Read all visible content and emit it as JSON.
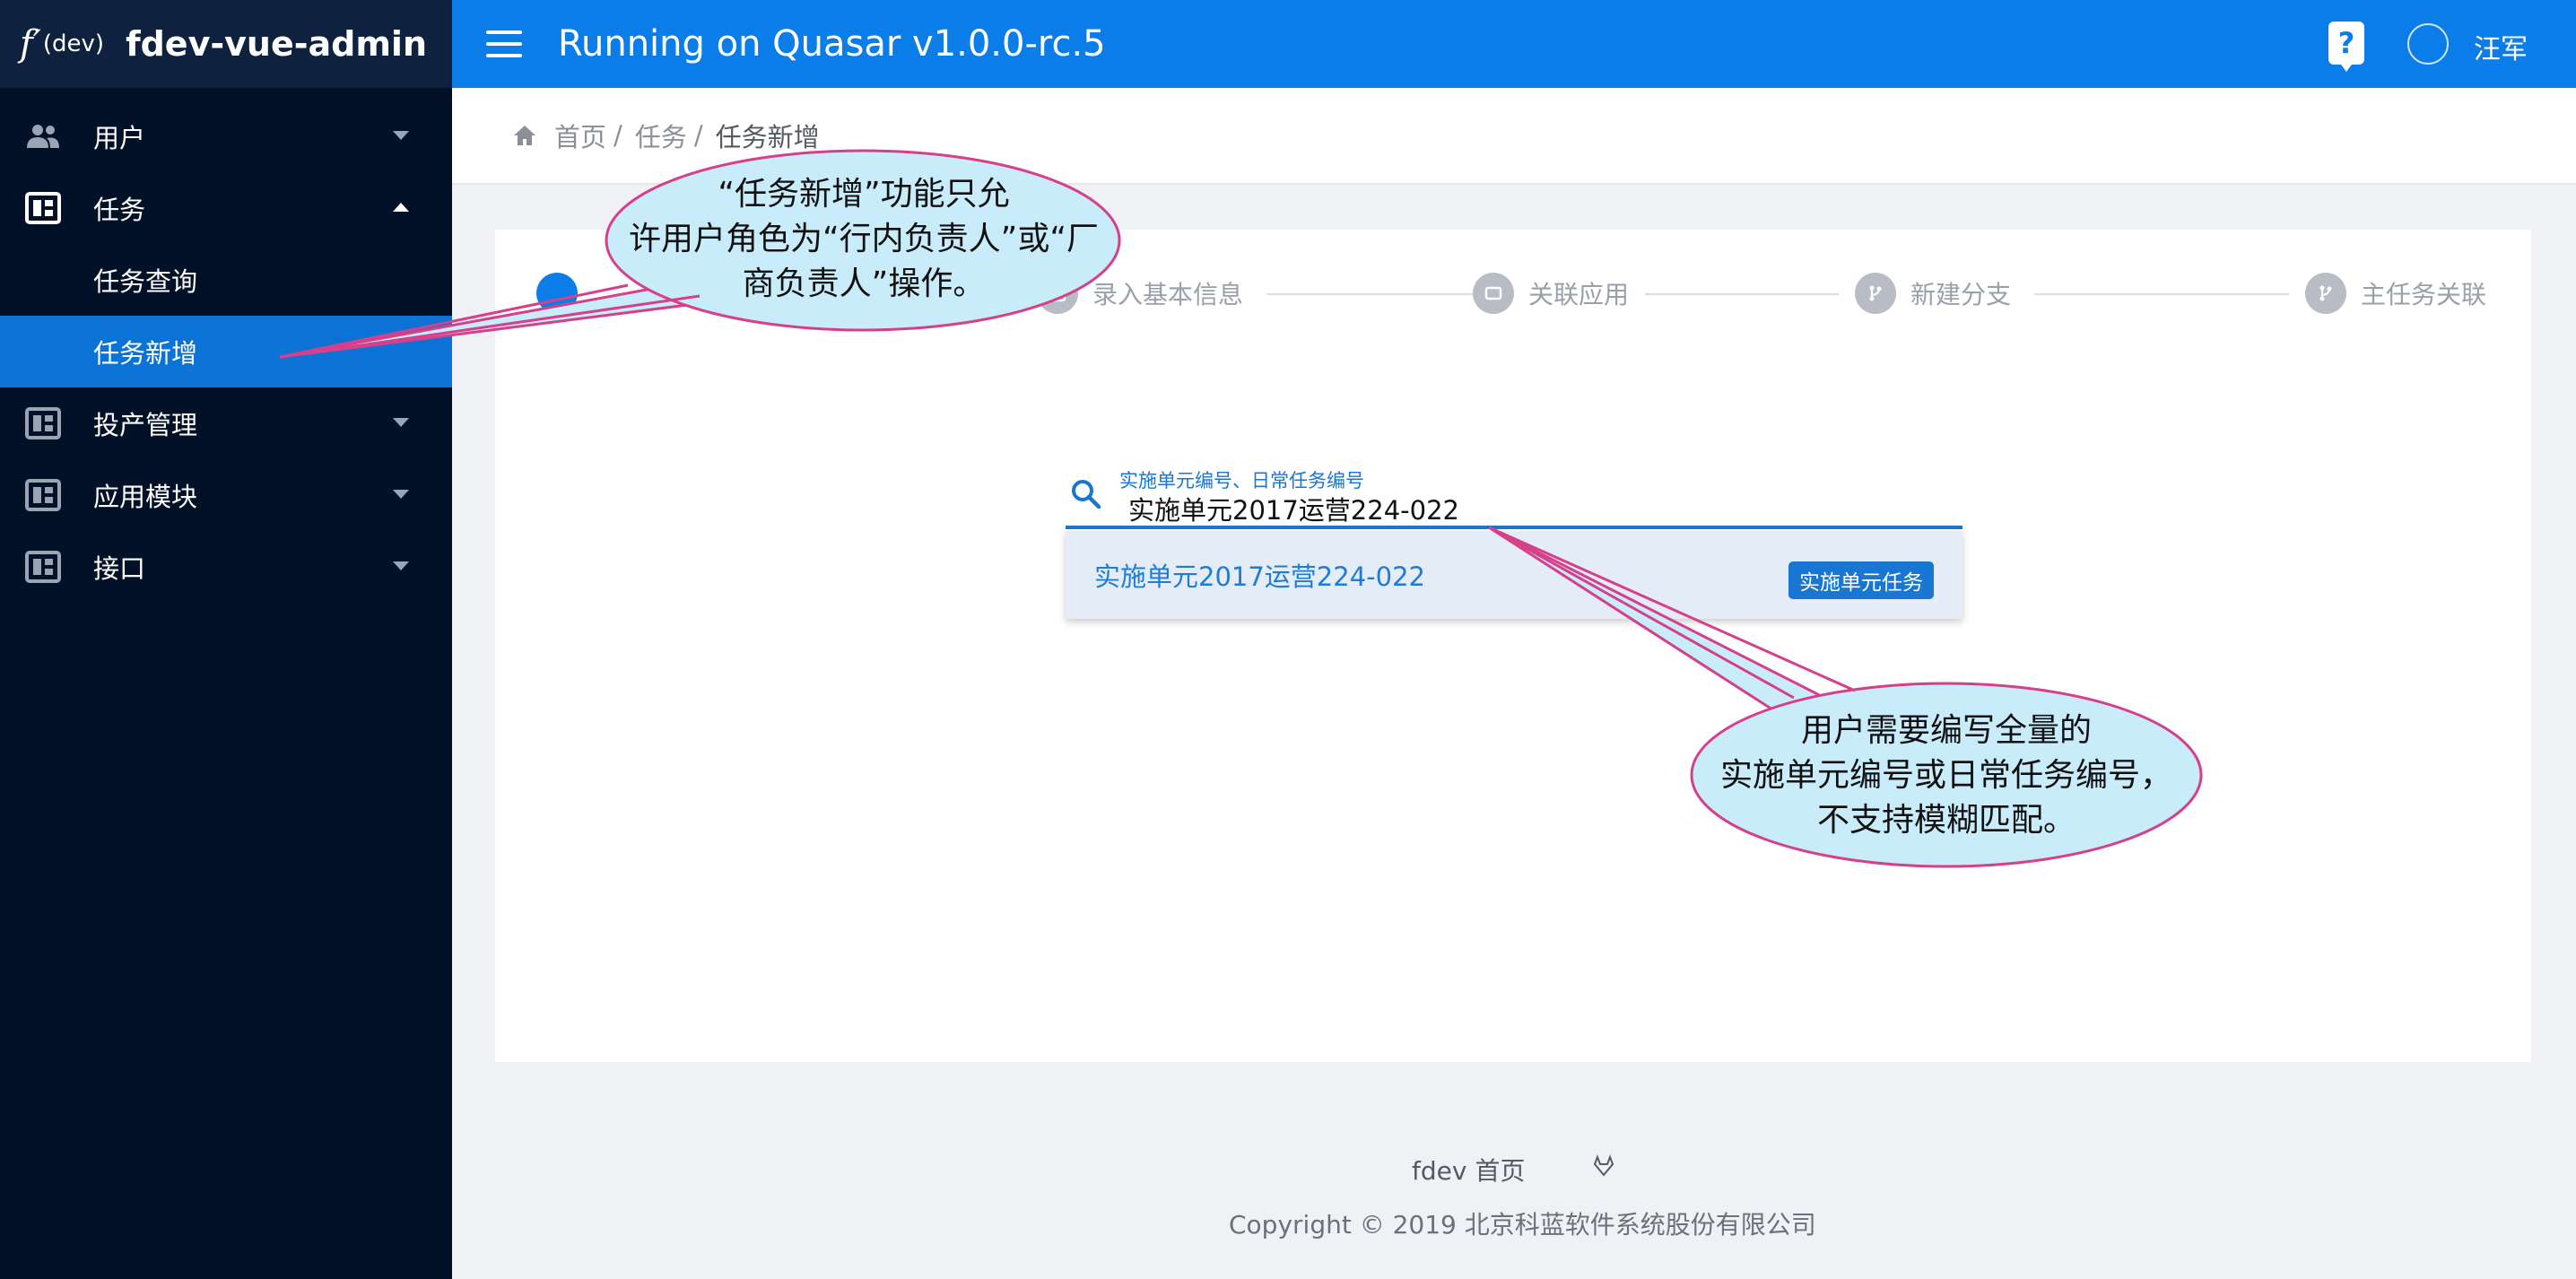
{
  "app": {
    "logo_glyph": "f′",
    "logo_sub": "(dev)",
    "title": "fdev-vue-admin"
  },
  "header": {
    "title": "Running on Quasar v1.0.0-rc.5",
    "help_icon": "?",
    "user_name": "汪军"
  },
  "sidebar": {
    "items": [
      {
        "label": "用户",
        "icon": "people-icon",
        "expanded": false
      },
      {
        "label": "任务",
        "icon": "dashboard-icon",
        "expanded": true,
        "children": [
          {
            "label": "任务查询",
            "active": false
          },
          {
            "label": "任务新增",
            "active": true
          }
        ]
      },
      {
        "label": "投产管理",
        "icon": "dashboard-icon",
        "expanded": false
      },
      {
        "label": "应用模块",
        "icon": "dashboard-icon",
        "expanded": false
      },
      {
        "label": "接口",
        "icon": "dashboard-icon",
        "expanded": false
      }
    ]
  },
  "breadcrumb": {
    "home": "首页",
    "section": "任务",
    "current": "任务新增",
    "separator": "/"
  },
  "stepper": {
    "steps": [
      "录入基本信息",
      "关联应用",
      "新建分支",
      "主任务关联"
    ]
  },
  "search": {
    "label": "实施单元编号、日常任务编号",
    "value": "实施单元2017运营224-022",
    "result_text": "实施单元2017运营224-022",
    "result_badge": "实施单元任务"
  },
  "footer": {
    "link": "fdev 首页",
    "copyright": "Copyright © 2019 北京科蓝软件系统股份有限公司"
  },
  "callouts": {
    "top_line1": "“任务新增”功能只允",
    "top_line2": "许用户角色为“行内负责人”或“厂",
    "top_line3": "商负责人”操作。",
    "bottom_line1": "用户需要编写全量的",
    "bottom_line2": "实施单元编号或日常任务编号，",
    "bottom_line3": "不支持模糊匹配。"
  },
  "colors": {
    "primary": "#0b7de8",
    "sidebar_bg": "#021127",
    "active_item": "#0b73d6",
    "callout_fill": "#c9ecfb",
    "callout_stroke": "#d6408a"
  }
}
